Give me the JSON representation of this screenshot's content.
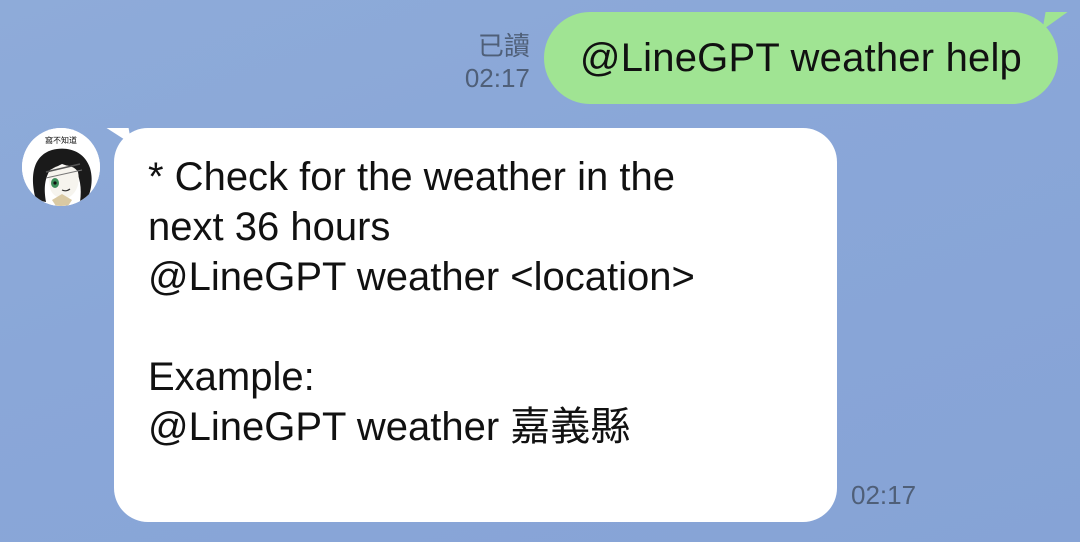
{
  "outgoing_message": {
    "read_status": "已讀",
    "time": "02:17",
    "text": "@LineGPT weather help"
  },
  "incoming_message": {
    "avatar_caption": "窩不知道",
    "lines": [
      "* Check for the weather in the",
      "next 36 hours",
      "@LineGPT weather <location>",
      "",
      "Example:",
      "@LineGPT weather 嘉義縣"
    ],
    "time": "02:17"
  },
  "colors": {
    "background": "#8aa7d8",
    "outgoing_bubble": "#a0e493",
    "incoming_bubble": "#ffffff",
    "meta_text": "#4f5f78"
  }
}
